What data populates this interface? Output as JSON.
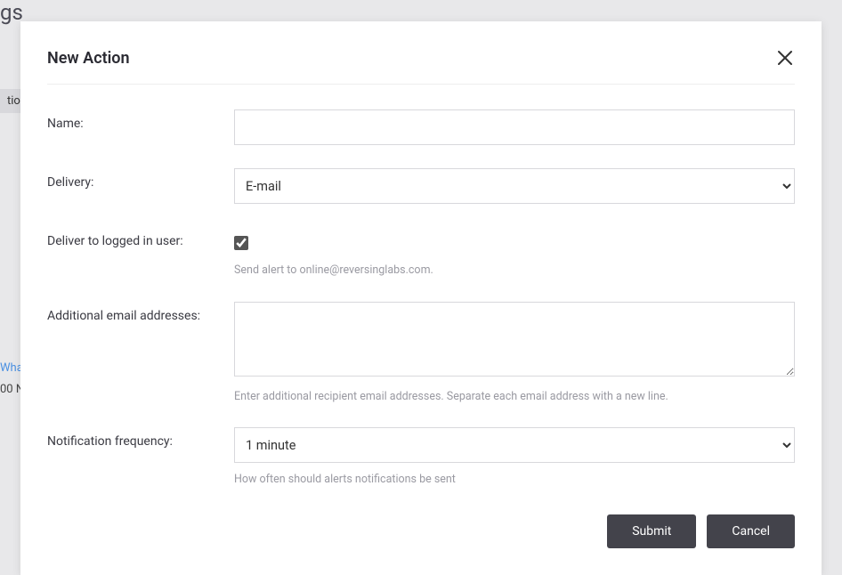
{
  "background": {
    "header_fragment": "gs",
    "tab_fragment": "tion",
    "link_fragment": "Wha",
    "text_fragment": "00 N"
  },
  "modal": {
    "title": "New Action",
    "fields": {
      "name_label": "Name:",
      "name_value": "",
      "delivery_label": "Delivery:",
      "delivery_value": "E-mail",
      "deliver_to_user_label": "Deliver to logged in user:",
      "deliver_to_user_checked": true,
      "deliver_to_user_help": "Send alert to online@reversinglabs.com.",
      "additional_emails_label": "Additional email addresses:",
      "additional_emails_value": "",
      "additional_emails_help": "Enter additional recipient email addresses. Separate each email address with a new line.",
      "frequency_label": "Notification frequency:",
      "frequency_value": "1 minute",
      "frequency_help": "How often should alerts notifications be sent"
    },
    "buttons": {
      "submit": "Submit",
      "cancel": "Cancel"
    }
  }
}
